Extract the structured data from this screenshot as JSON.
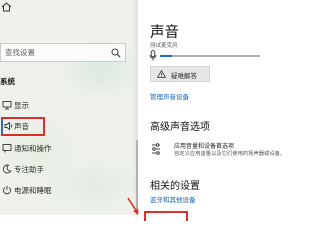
{
  "sidebar": {
    "home_label": "",
    "search_placeholder": "查找设置",
    "section_title": "系统",
    "items": [
      {
        "label": "显示",
        "icon": "display-icon"
      },
      {
        "label": "声音",
        "icon": "speaker-icon",
        "selected": true
      },
      {
        "label": "通知和操作",
        "icon": "notification-icon"
      },
      {
        "label": "专注助手",
        "icon": "moon-icon"
      },
      {
        "label": "电源和睡眠",
        "icon": "power-icon"
      }
    ]
  },
  "main": {
    "title": "声音",
    "output_device_caption": "测试麦克风",
    "volume_level": 0.12,
    "troubleshoot_label": "疑难解答",
    "manage_devices_link": "管理声音设备",
    "advanced": {
      "heading": "高级声音选项",
      "item_title": "应用音量和设备首选项",
      "item_description": "自定义应用音量以及它们使用的扬声器或设备。"
    },
    "related": {
      "heading": "相关的设置",
      "link": "蓝牙和其他设备"
    }
  },
  "colors": {
    "accent": "#1a73c7",
    "link": "#1364b7",
    "annotation_red": "#d9302c",
    "sidebar_bg": "#eef1ec"
  }
}
